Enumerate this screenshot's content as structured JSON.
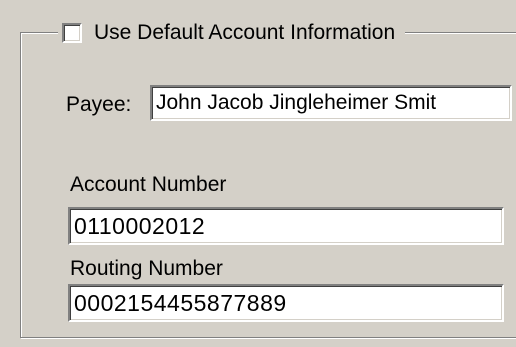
{
  "group": {
    "checkbox_label": "Use Default Account Information",
    "checkbox_checked": false
  },
  "payee": {
    "label": "Payee:",
    "value": "John Jacob Jingleheimer Smit"
  },
  "account": {
    "label": "Account Number",
    "value": "0110002012"
  },
  "routing": {
    "label": "Routing Number",
    "value": "0002154455877889"
  },
  "colors": {
    "window_background": "#d4d0c8",
    "field_background": "#ffffff",
    "shadow": "#808080",
    "highlight": "#ffffff"
  }
}
